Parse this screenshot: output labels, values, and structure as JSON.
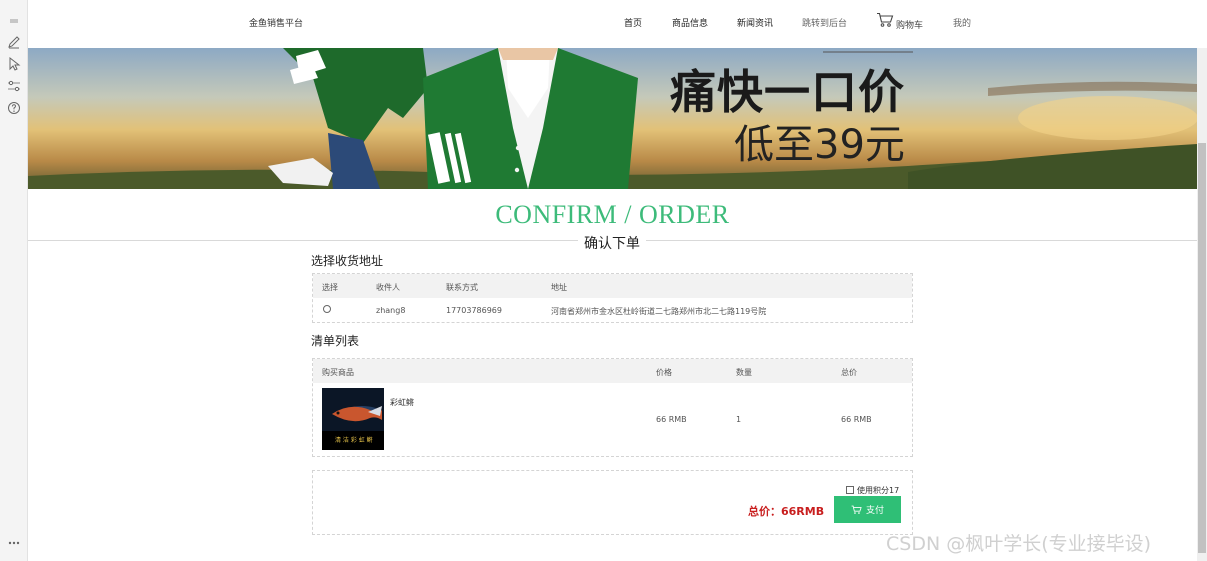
{
  "header": {
    "brand": "金鱼销售平台",
    "nav": [
      {
        "label": "首页"
      },
      {
        "label": "商品信息"
      },
      {
        "label": "新闻资讯"
      },
      {
        "label": "跳转到后台"
      }
    ],
    "cart_label": "购物车",
    "my_label": "我的"
  },
  "banner": {
    "headline": "痛快一口价",
    "subline": "低至39元"
  },
  "confirm": {
    "title": "CONFIRM / ORDER",
    "subtitle": "确认下单"
  },
  "address": {
    "section_label": "选择收货地址",
    "columns": [
      "选择",
      "收件人",
      "联系方式",
      "地址"
    ],
    "rows": [
      {
        "selected": false,
        "recipient": "zhang8",
        "phone": "17703786969",
        "address": "河南省郑州市金水区杜岭街道二七路郑州市北二七路119号院"
      }
    ]
  },
  "items": {
    "section_label": "清单列表",
    "columns": [
      "购买商品",
      "价格",
      "数量",
      "总价"
    ],
    "rows": [
      {
        "name": "彩虹鳉",
        "price": "66 RMB",
        "qty": "1",
        "total": "66 RMB",
        "image_caption": "清 洁 彩 虹 鳉"
      }
    ]
  },
  "checkout": {
    "points_label": "使用积分17",
    "total_label": "总价：66RMB",
    "pay_label": "支付"
  },
  "watermark": "CSDN @枫叶学长(专业接毕设)",
  "colors": {
    "accent_green": "#2fbf76",
    "title_green": "#3dbb7a",
    "total_red": "#c81e1e"
  }
}
